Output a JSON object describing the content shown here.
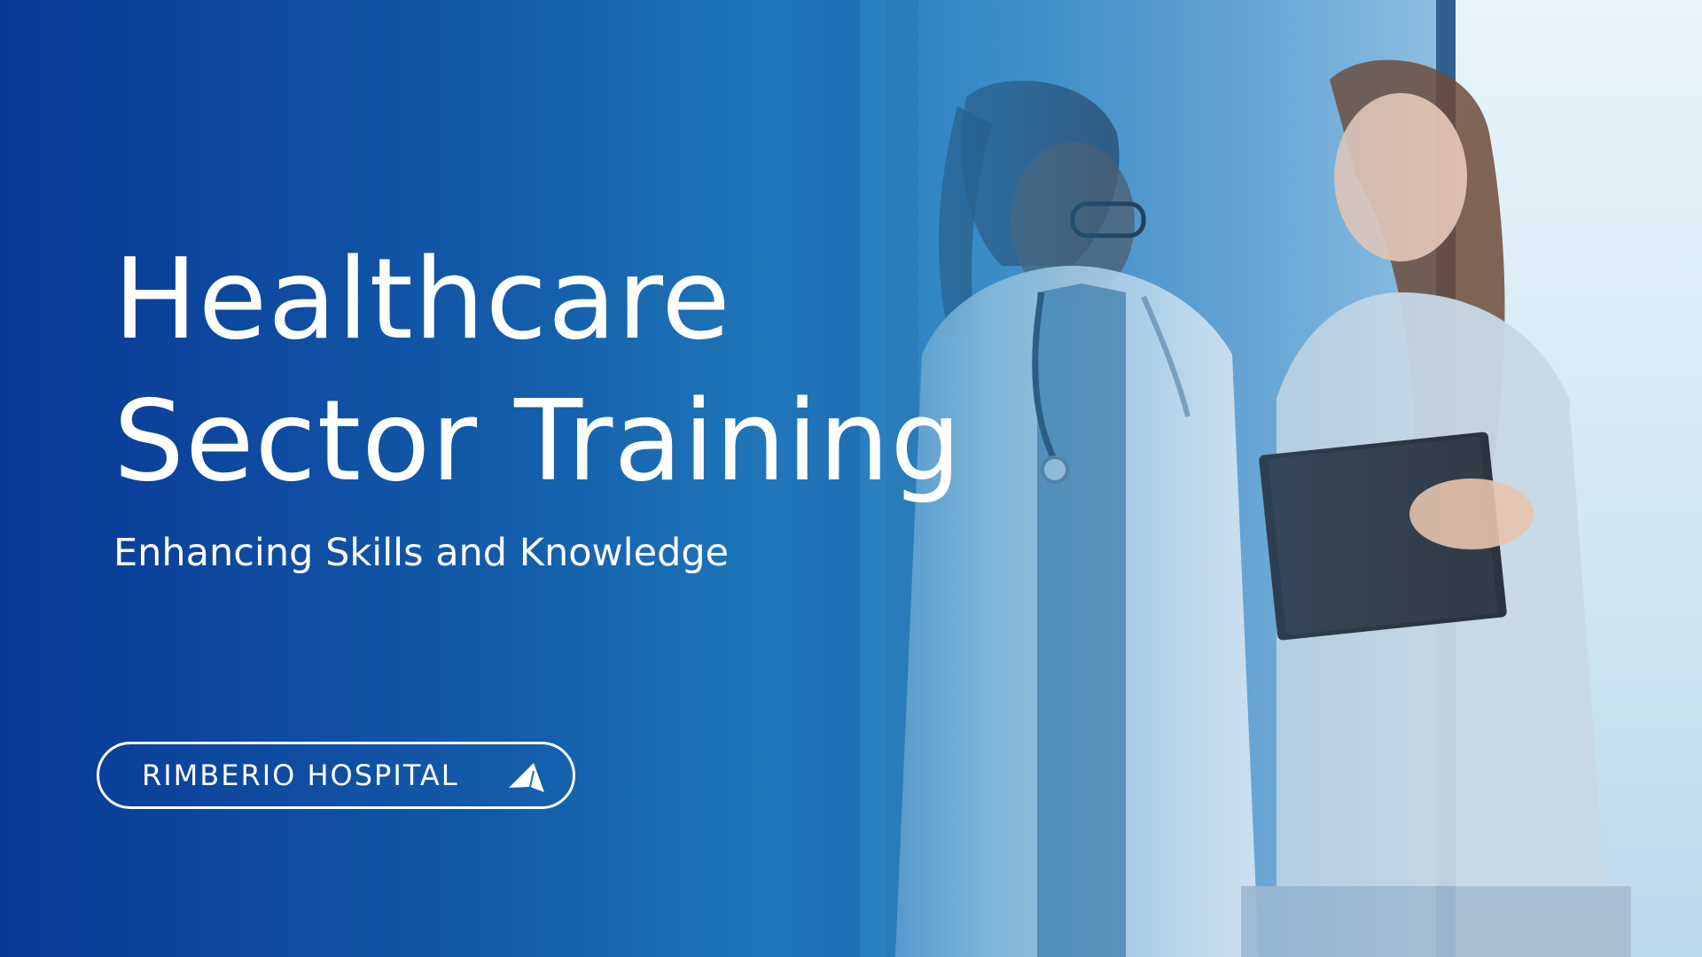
{
  "slide": {
    "title_line_1": "Healthcare",
    "title_line_2": "Sector Training",
    "subtitle": "Enhancing Skills and Knowledge",
    "cta_label": "RIMBERIO HOSPITAL",
    "cta_icon": "arrow-cursor-icon"
  },
  "colors": {
    "background": "#0a3c97",
    "text": "#ffffff",
    "accent": "#2a82c0"
  }
}
